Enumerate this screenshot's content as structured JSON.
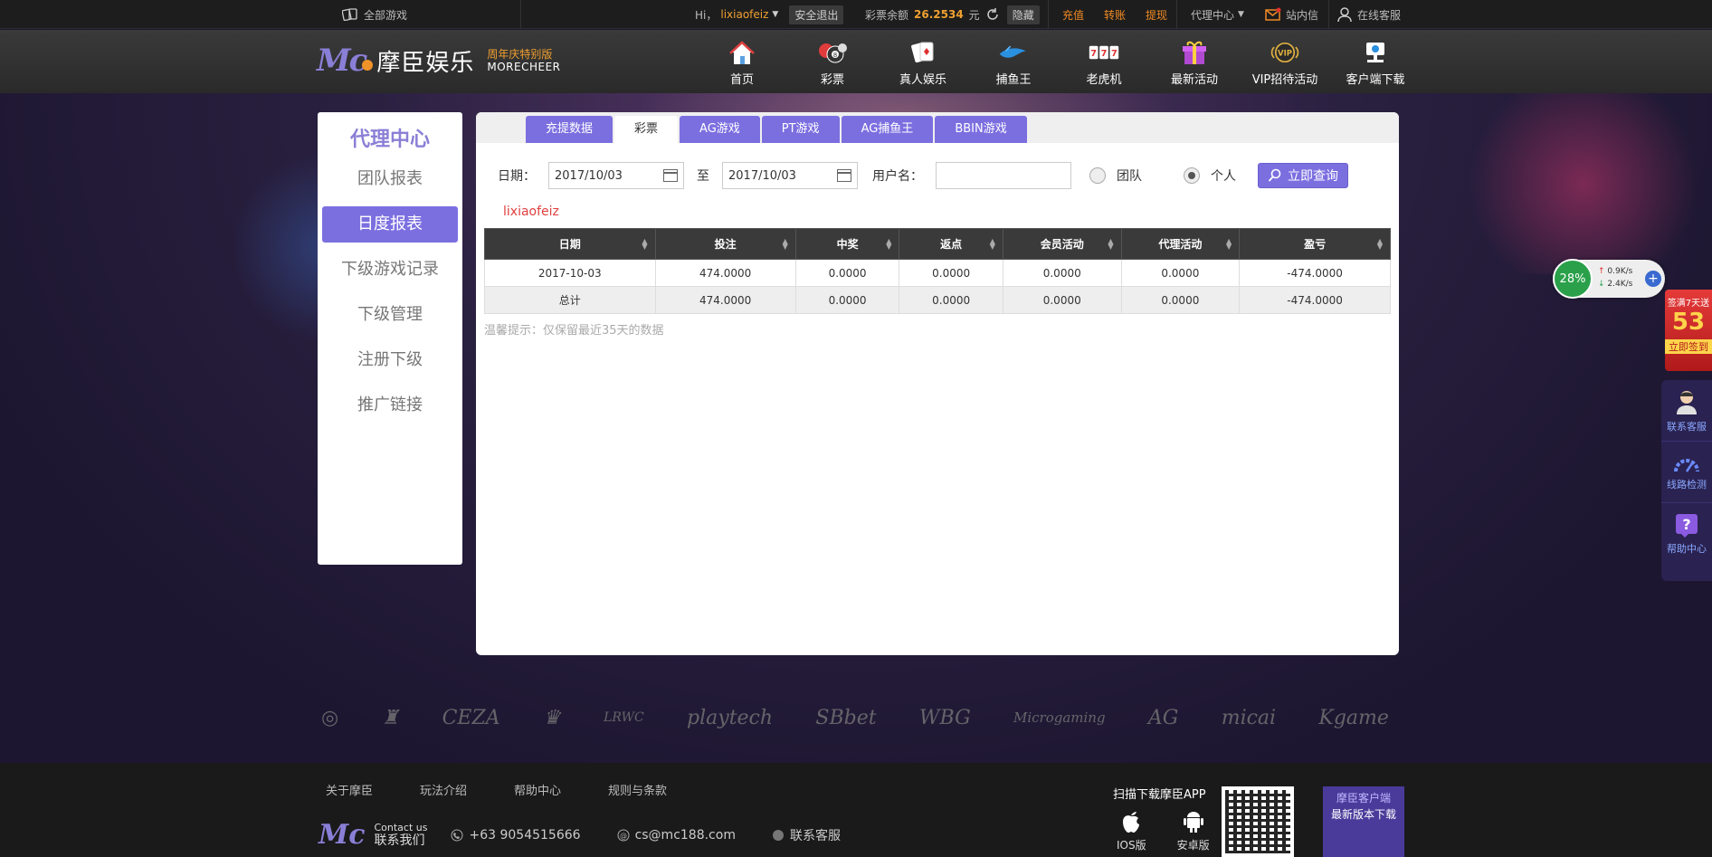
{
  "topbar": {
    "all_games": "全部游戏",
    "greeting": "Hi，",
    "username": "lixiaofeiz",
    "logout": "安全退出",
    "balance_label": "彩票余额",
    "balance_value": "26.2534",
    "currency": "元",
    "hide": "隐藏",
    "recharge": "充值",
    "transfer": "转账",
    "withdraw": "提现",
    "agent_center": "代理中心",
    "inbox": "站内信",
    "online_service": "在线客服"
  },
  "header": {
    "logo_cn": "摩臣娱乐",
    "logo_sub1": "周年庆特别版",
    "logo_sub2": "MORECHEER",
    "nav": [
      {
        "label": "首页",
        "icon": "home-icon"
      },
      {
        "label": "彩票",
        "icon": "lottery-balls-icon"
      },
      {
        "label": "真人娱乐",
        "icon": "playing-cards-icon"
      },
      {
        "label": "捕鱼王",
        "icon": "fish-icon"
      },
      {
        "label": "老虎机",
        "icon": "slot-machine-icon"
      },
      {
        "label": "最新活动",
        "icon": "gift-icon"
      },
      {
        "label": "VIP招待活动",
        "icon": "vip-badge-icon"
      },
      {
        "label": "客户端下载",
        "icon": "client-download-icon"
      }
    ]
  },
  "sidebar": {
    "title": "代理中心",
    "items": [
      "团队报表",
      "日度报表",
      "下级游戏记录",
      "下级管理",
      "注册下级",
      "推广链接"
    ],
    "active_index": 1
  },
  "tabs": [
    "充提数据",
    "彩票",
    "AG游戏",
    "PT游戏",
    "AG捕鱼王",
    "BBIN游戏"
  ],
  "active_tab": 1,
  "filter": {
    "date_label": "日期：",
    "date_from": "2017/10/03",
    "to_label": "至",
    "date_to": "2017/10/03",
    "user_label": "用户名：",
    "user_value": "",
    "team_label": "团队",
    "personal_label": "个人",
    "selected": "personal",
    "query_button": "立即查询"
  },
  "report_user": "lixiaofeiz",
  "table": {
    "columns": [
      "日期",
      "投注",
      "中奖",
      "返点",
      "会员活动",
      "代理活动",
      "盈亏"
    ],
    "rows": [
      [
        "2017-10-03",
        "474.0000",
        "0.0000",
        "0.0000",
        "0.0000",
        "0.0000",
        "-474.0000"
      ]
    ],
    "total": [
      "总计",
      "474.0000",
      "0.0000",
      "0.0000",
      "0.0000",
      "0.0000",
      "-474.0000"
    ]
  },
  "tip": "温馨提示：仅保留最近35天的数据",
  "partners": [
    "CEZA",
    "playtech",
    "SBbet",
    "WBG",
    "Microgaming",
    "AG",
    "micai",
    "Kgame"
  ],
  "footer": {
    "links": [
      "关于摩臣",
      "玩法介绍",
      "帮助中心",
      "规则与条款"
    ],
    "contact_en": "Contact us",
    "contact_cn": "联系我们",
    "phone": "+63 9054515666",
    "email": "cs@mc188.com",
    "live_chat": "联系客服",
    "app_title": "扫描下载摩臣APP",
    "ios": "IOS版",
    "android": "安卓版",
    "client_title": "摩臣客户端",
    "client_sub": "最新版本下载"
  },
  "speed_widget": {
    "percent": "28%",
    "up": "0.9K/s",
    "down": "2.4K/s"
  },
  "side_float": {
    "promo_top": "签满7天送",
    "promo_big": "53",
    "promo_sign": "立即签到",
    "service": "联系客服",
    "line_check": "线路检测",
    "help": "帮助中心"
  }
}
